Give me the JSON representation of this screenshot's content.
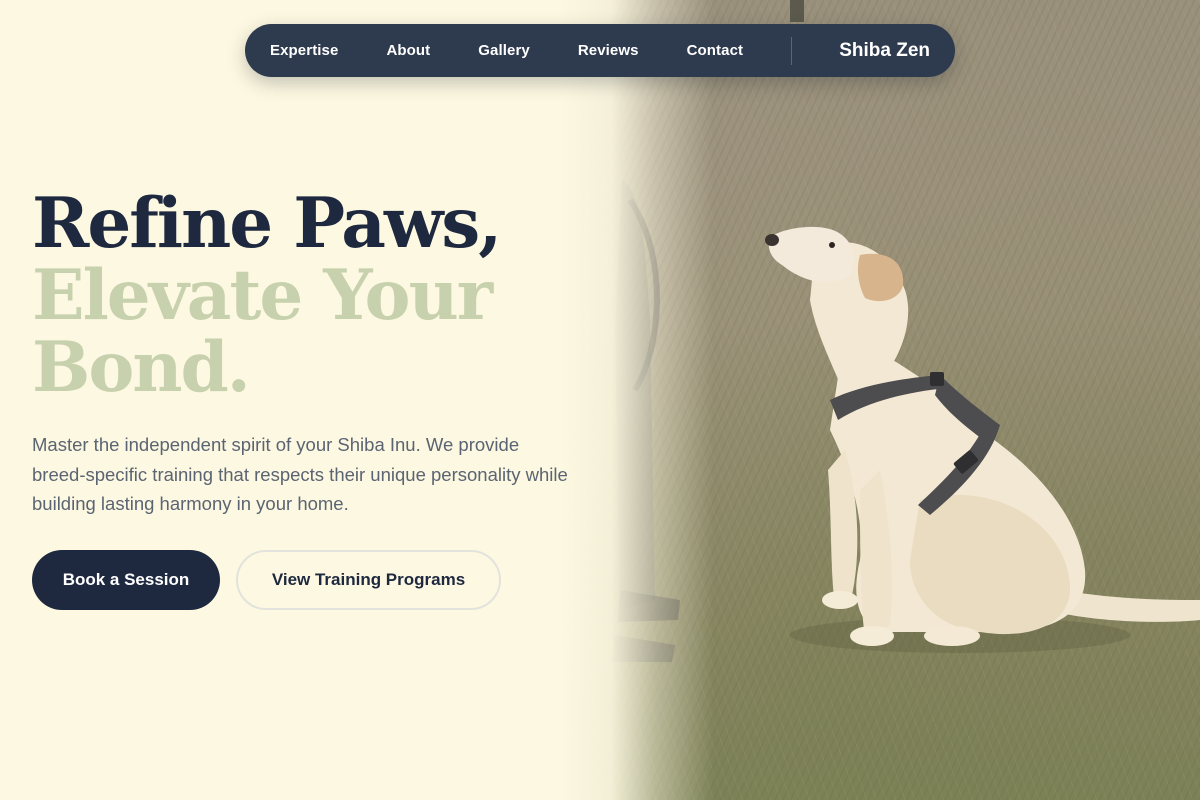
{
  "nav": {
    "links": [
      "Expertise",
      "About",
      "Gallery",
      "Reviews",
      "Contact"
    ],
    "brand": "Shiba Zen"
  },
  "hero": {
    "headline_line1": "Refine Paws,",
    "headline_line2": "Elevate Your",
    "headline_line3": "Bond.",
    "description": "Master the independent spirit of your Shiba Inu. We provide breed-specific training that respects their unique personality while building lasting harmony in your home.",
    "primary_button": "Book a Session",
    "secondary_button": "View Training Programs",
    "image_alt": "Dog wearing a harness sitting on grass"
  },
  "colors": {
    "background": "#fdf8e1",
    "navy": "#1e2940",
    "nav_bg": "#2e3a4d",
    "sage": "#c8d1ad",
    "body_text": "#5b6472"
  }
}
